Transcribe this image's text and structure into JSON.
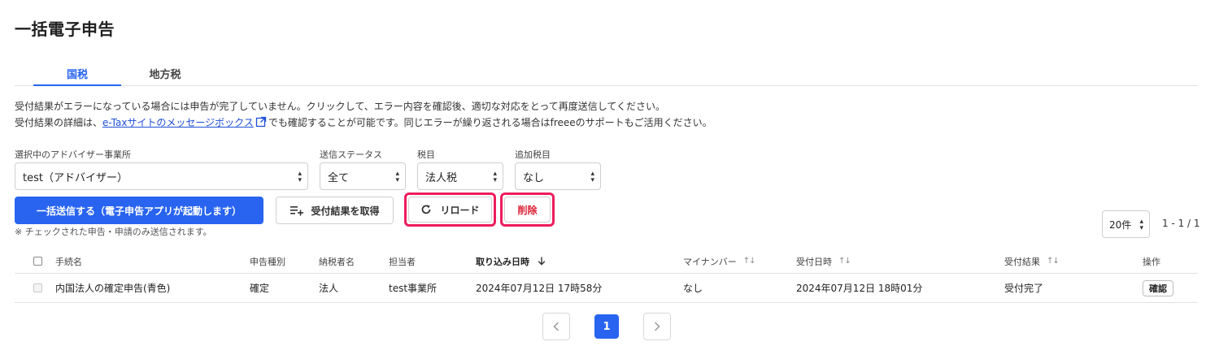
{
  "page": {
    "title": "一括電子申告"
  },
  "tabs": [
    {
      "label": "国税",
      "active": true
    },
    {
      "label": "地方税",
      "active": false
    }
  ],
  "notice": {
    "line1": "受付結果がエラーになっている場合には申告が完了していません。クリックして、エラー内容を確認後、適切な対応をとって再度送信してください。",
    "line2_prefix": "受付結果の詳細は、",
    "line2_link": "e-Taxサイトのメッセージボックス",
    "line2_suffix": "でも確認することが可能です。同じエラーが繰り返される場合はfreeeのサポートもご活用ください。"
  },
  "filters": {
    "advisor": {
      "label": "選択中のアドバイザー事業所",
      "value": "test（アドバイザー）"
    },
    "status": {
      "label": "送信ステータス",
      "value": "全て"
    },
    "tax_item": {
      "label": "税目",
      "value": "法人税"
    },
    "additional_tax": {
      "label": "追加税目",
      "value": "なし"
    }
  },
  "actions": {
    "bulk_send": "一括送信する（電子申告アプリが起動します）",
    "fetch_results": "受付結果を取得",
    "reload": "リロード",
    "delete": "削除",
    "note": "※ チェックされた申告・申請のみ送信されます。"
  },
  "pagination": {
    "per_page": "20件",
    "range": "1 - 1 / 1",
    "current": "1"
  },
  "table": {
    "headers": {
      "procedure": "手続名",
      "type": "申告種別",
      "taxpayer": "納税者名",
      "assignee": "担当者",
      "imported_at": "取り込み日時",
      "my_number": "マイナンバー",
      "received_at": "受付日時",
      "result": "受付結果",
      "operation": "操作"
    },
    "rows": [
      {
        "procedure": "内国法人の確定申告(青色)",
        "type": "確定",
        "taxpayer": "法人",
        "assignee": "test事業所",
        "imported_at": "2024年07月12日 17時58分",
        "my_number": "なし",
        "received_at": "2024年07月12日 18時01分",
        "result": "受付完了",
        "operation": "確認"
      }
    ]
  },
  "colors": {
    "primary": "#2864f0",
    "danger": "#dc1e32",
    "highlight": "#ee1c5c"
  },
  "icons": {
    "external_link": "external-link-icon",
    "fetch": "list-add-icon",
    "reload": "refresh-icon",
    "sort_desc": "arrow-down-icon",
    "sort_both": "sort-icon",
    "prev": "chevron-left-icon",
    "next": "chevron-right-icon"
  }
}
